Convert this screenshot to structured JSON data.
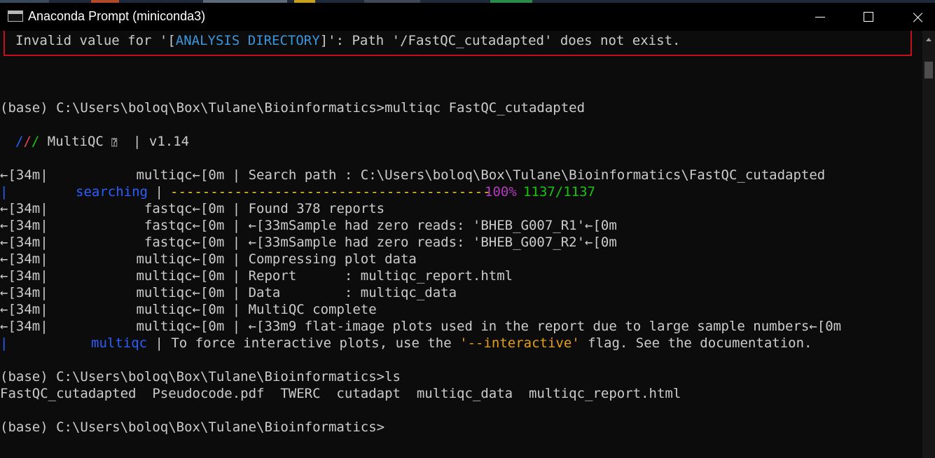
{
  "window": {
    "title": "Anaconda Prompt (miniconda3)"
  },
  "colors": {
    "background": "#0c0c0c",
    "text": "#cccccc",
    "error_border": "#c50f1f",
    "blue": "#2b5fff",
    "cyan": "#3a96dd",
    "green": "#16c60c",
    "purple": "#b33ac0",
    "orange": "#e5a012"
  },
  "error": {
    "text_before": "Invalid value for '[",
    "highlight": "ANALYSIS DIRECTORY",
    "text_after": "]': Path '/FastQC_cutadapted' does not exist."
  },
  "cmd1": {
    "prompt": "(base) C:\\Users\\boloq\\Box\\Tulane\\Bioinformatics>",
    "command": "multiqc FastQC_cutadapted"
  },
  "banner": {
    "s1": "/",
    "s2": "/",
    "s3": "/",
    "name": " MultiQC ",
    "glyph": "⍰",
    "version": "  | v1.14"
  },
  "log": {
    "search_path": {
      "prefix": "←[34m|           ",
      "module": "multiqc",
      "suffix": "←[0m | Search path : C:\\Users\\boloq\\Box\\Tulane\\Bioinformatics\\FastQC_cutadapted"
    },
    "searching": {
      "label": "searching",
      "sep": " | ",
      "bar": "----------------------------------------",
      "percent": "100%",
      "count": "1137/1137"
    },
    "lines": [
      {
        "prefix": "←[34m|            ",
        "module": "fastqc",
        "suffix": "←[0m | Found 378 reports"
      },
      {
        "prefix": "←[34m|            ",
        "module": "fastqc",
        "suffix": "←[0m | ←[33mSample had zero reads: 'BHEB_G007_R1'←[0m"
      },
      {
        "prefix": "←[34m|            ",
        "module": "fastqc",
        "suffix": "←[0m | ←[33mSample had zero reads: 'BHEB_G007_R2'←[0m"
      },
      {
        "prefix": "←[34m|           ",
        "module": "multiqc",
        "suffix": "←[0m | Compressing plot data"
      },
      {
        "prefix": "←[34m|           ",
        "module": "multiqc",
        "suffix": "←[0m | Report      : multiqc_report.html"
      },
      {
        "prefix": "←[34m|           ",
        "module": "multiqc",
        "suffix": "←[0m | Data        : multiqc_data"
      },
      {
        "prefix": "←[34m|           ",
        "module": "multiqc",
        "suffix": "←[0m | MultiQC complete"
      },
      {
        "prefix": "←[34m|           ",
        "module": "multiqc",
        "suffix": "←[0m | ←[33m9 flat-image plots used in the report due to large sample numbers←[0m"
      }
    ],
    "interactive": {
      "module": "multiqc",
      "text_before": " | To force interactive plots, use the ",
      "flag": "'--interactive'",
      "text_after": " flag. See the documentation."
    }
  },
  "cmd2": {
    "prompt": "(base) C:\\Users\\boloq\\Box\\Tulane\\Bioinformatics>",
    "command": "ls",
    "output": "FastQC_cutadapted  Pseudocode.pdf  TWERC  cutadapt  multiqc_data  multiqc_report.html"
  },
  "cmd3": {
    "prompt": "(base) C:\\Users\\boloq\\Box\\Tulane\\Bioinformatics>"
  }
}
